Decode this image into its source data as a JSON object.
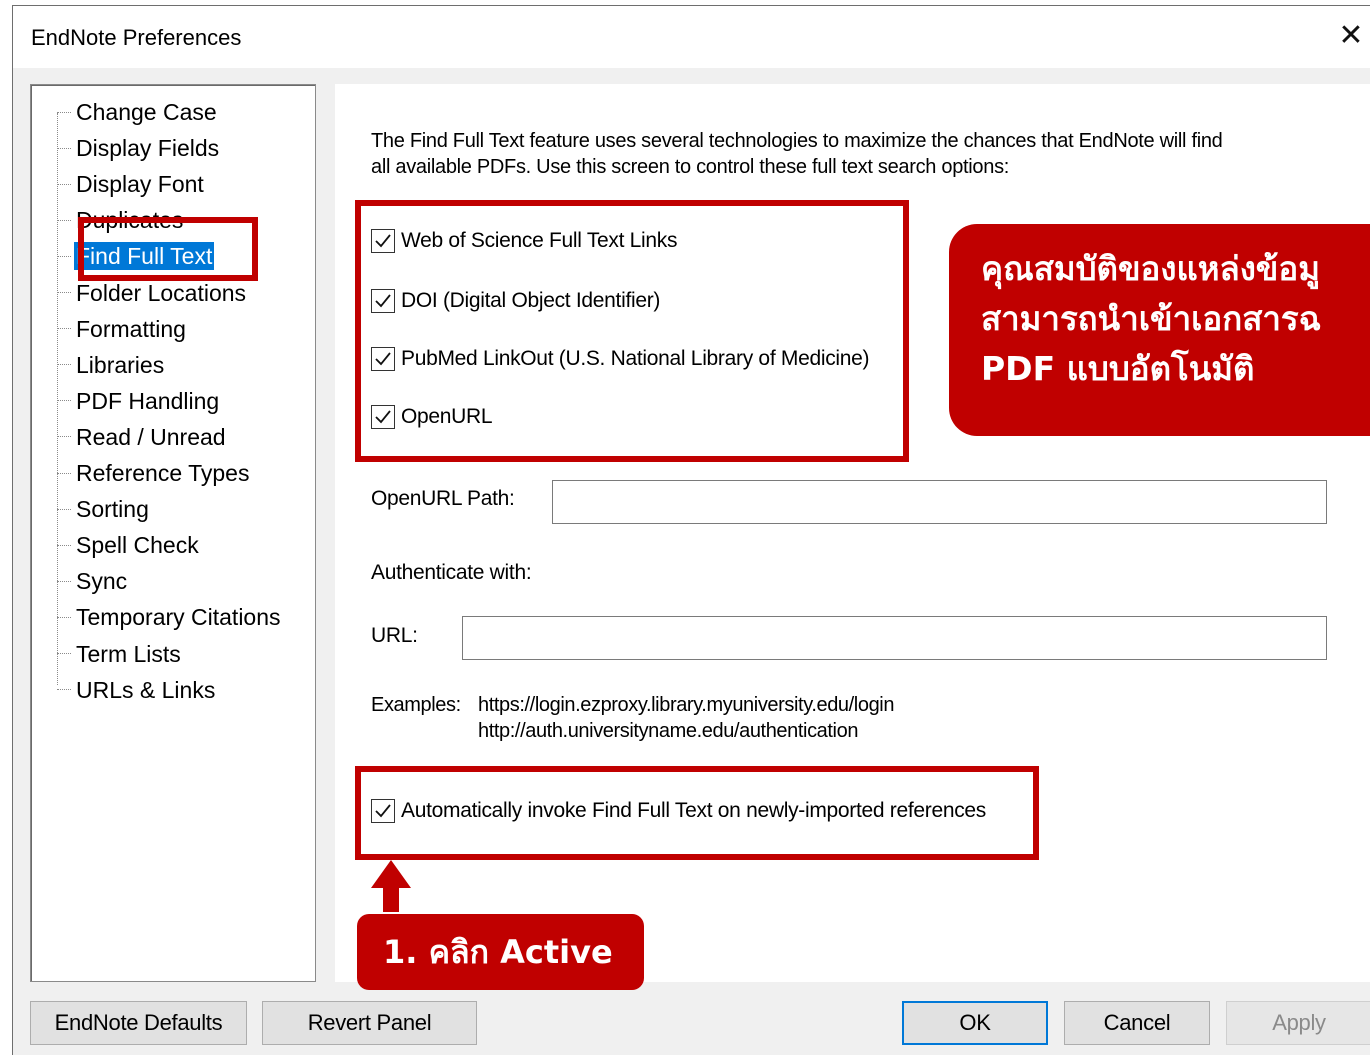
{
  "window": {
    "title": "EndNote Preferences",
    "close_glyph": "✕"
  },
  "tree": {
    "items": [
      {
        "label": "Change Case"
      },
      {
        "label": "Display Fields"
      },
      {
        "label": "Display Font"
      },
      {
        "label": "Duplicates"
      },
      {
        "label": "Find Full Text",
        "selected": true
      },
      {
        "label": "Folder Locations"
      },
      {
        "label": "Formatting"
      },
      {
        "label": "Libraries"
      },
      {
        "label": "PDF Handling"
      },
      {
        "label": "Read / Unread"
      },
      {
        "label": "Reference Types"
      },
      {
        "label": "Sorting"
      },
      {
        "label": "Spell Check"
      },
      {
        "label": "Sync"
      },
      {
        "label": "Temporary Citations"
      },
      {
        "label": "Term Lists"
      },
      {
        "label": "URLs & Links"
      }
    ]
  },
  "panel": {
    "intro_line1": "The Find Full Text feature uses several technologies to maximize the chances that EndNote will find",
    "intro_line2": "all available PDFs. Use this screen to control these full text search options:",
    "options": [
      {
        "label": "Web of Science Full Text Links",
        "checked": true
      },
      {
        "label": "DOI (Digital Object Identifier)",
        "checked": true
      },
      {
        "label": "PubMed LinkOut (U.S. National Library of Medicine)",
        "checked": true
      },
      {
        "label": "OpenURL",
        "checked": true
      }
    ],
    "openurl_path_label": "OpenURL Path:",
    "openurl_path_value": "",
    "authenticate_label": "Authenticate with:",
    "url_label": "URL:",
    "url_value": "",
    "examples_label": "Examples:",
    "example_1": "https://login.ezproxy.library.myuniversity.edu/login",
    "example_2": "http://auth.universityname.edu/authentication",
    "auto_invoke": {
      "label": "Automatically invoke Find Full Text on newly-imported references",
      "checked": true
    }
  },
  "annotations": {
    "callout_line1": "คุณสมบัติของแหล่งข้อมู",
    "callout_line2": "สามารถนำเข้าเอกสารฉ",
    "callout_line3": "PDF แบบอัตโนมัติ",
    "step_label": "1. คลิก Active",
    "highlight_color": "#c00000"
  },
  "buttons": {
    "endnote_defaults": "EndNote Defaults",
    "revert_panel": "Revert Panel",
    "ok": "OK",
    "cancel": "Cancel",
    "apply": "Apply"
  },
  "colors": {
    "selection": "#0078d7",
    "accent_red": "#c00000"
  }
}
